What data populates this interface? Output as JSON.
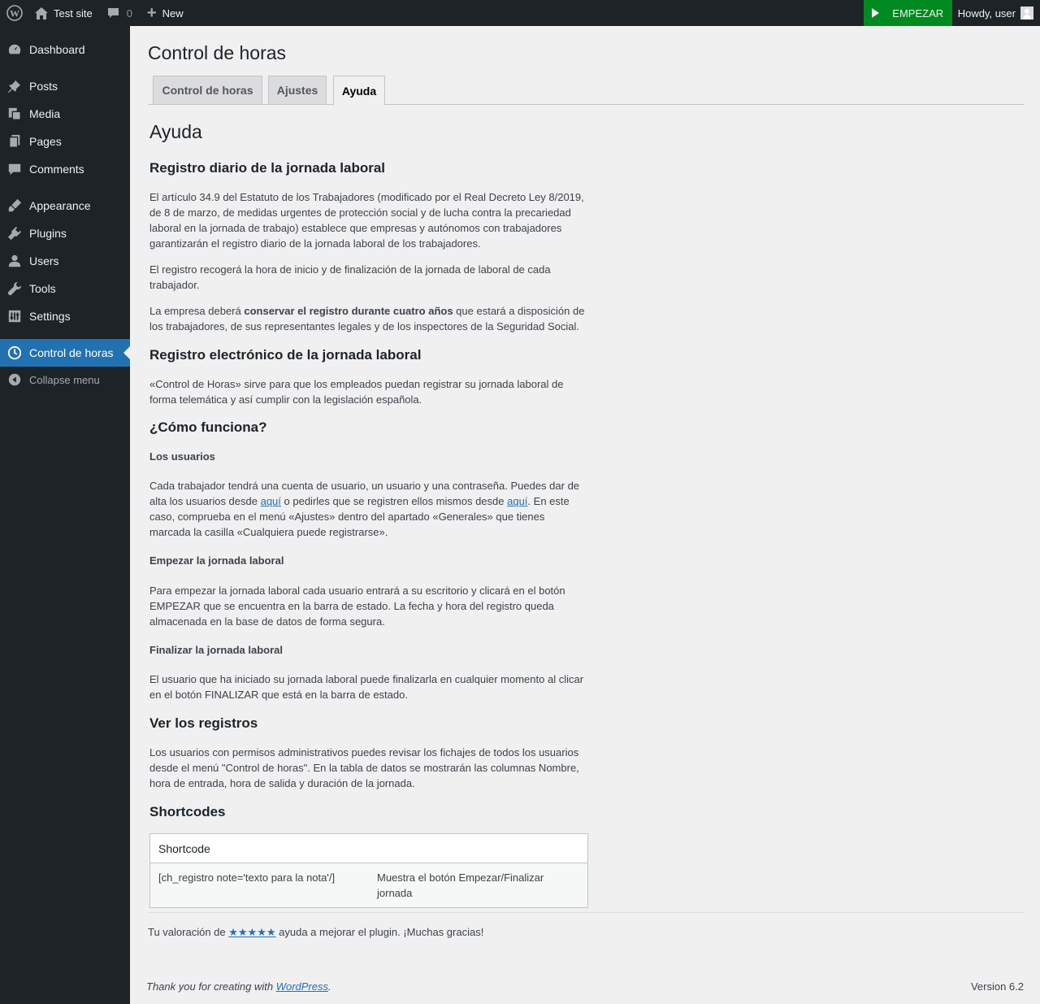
{
  "adminbar": {
    "site_name": "Test site",
    "comments_count": "0",
    "new_label": "New",
    "empezar_label": "EMPEZAR",
    "howdy_label": "Howdy, user"
  },
  "sidebar": {
    "items": [
      {
        "label": "Dashboard",
        "icon": "dashboard-icon"
      },
      {
        "label": "Posts",
        "icon": "pin-icon"
      },
      {
        "label": "Media",
        "icon": "media-icon"
      },
      {
        "label": "Pages",
        "icon": "pages-icon"
      },
      {
        "label": "Comments",
        "icon": "comment-icon"
      },
      {
        "label": "Appearance",
        "icon": "brush-icon"
      },
      {
        "label": "Plugins",
        "icon": "plug-icon"
      },
      {
        "label": "Users",
        "icon": "user-icon"
      },
      {
        "label": "Tools",
        "icon": "wrench-icon"
      },
      {
        "label": "Settings",
        "icon": "settings-icon"
      },
      {
        "label": "Control de horas",
        "icon": "clock-icon"
      },
      {
        "label": "Collapse menu",
        "icon": "collapse-icon"
      }
    ]
  },
  "page": {
    "title": "Control de horas",
    "tabs": [
      {
        "label": "Control de horas"
      },
      {
        "label": "Ajustes"
      },
      {
        "label": "Ayuda"
      }
    ]
  },
  "help": {
    "title": "Ayuda",
    "s1_title": "Registro diario de la jornada laboral",
    "s1_p1": "El artículo 34.9 del Estatuto de los Trabajadores (modificado por el Real Decreto Ley 8/2019, de 8 de marzo, de medidas urgentes de protección social y de lucha contra la precariedad laboral en la jornada de trabajo) establece que empresas y autónomos con trabajadores garantizarán el registro diario de la jornada laboral de los trabajadores.",
    "s1_p2": "El registro recogerá la hora de inicio y de finalización de la jornada de laboral de cada trabajador.",
    "s1_p3_a": "La empresa deberá ",
    "s1_p3_b": "conservar el registro durante cuatro años",
    "s1_p3_c": " que estará a disposición de los trabajadores, de sus representantes legales y de los inspectores de la Seguridad Social.",
    "s2_title": "Registro electrónico de la jornada laboral",
    "s2_p1": "«Control de Horas» sirve para que los empleados puedan registrar su jornada laboral de forma telemática y así cumplir con la legislación española.",
    "s3_title": "¿Cómo funciona?",
    "users_title": "Los usuarios",
    "users_p_a": "Cada trabajador tendrá una cuenta de usuario, un usuario y una contraseña. Puedes dar de alta los usuarios desde ",
    "users_link1": "aquí",
    "users_p_b": " o pedirles que se registren ellos mismos desde ",
    "users_link2": "aquí",
    "users_p_c": ". En este caso, comprueba en el menú «Ajustes» dentro del apartado «Generales» que tienes marcada la casilla «Cualquiera puede registrarse».",
    "start_title": "Empezar la jornada laboral",
    "start_p": "Para empezar la jornada laboral cada usuario entrará a su escritorio y clicará en el botón EMPEZAR que se encuentra en la barra de estado. La fecha y hora del registro queda almacenada en la base de datos de forma segura.",
    "end_title": "Finalizar la jornada laboral",
    "end_p": "El usuario que ha iniciado su jornada laboral puede finalizarla en cualquier momento al clicar en el botón FINALIZAR que está en la barra de estado.",
    "s4_title": "Ver los registros",
    "s4_p": "Los usuarios con permisos administrativos puedes revisar los fichajes de todos los usuarios desde el menú \"Control de horas\". En la tabla de datos se mostrarán las columnas Nombre, hora de entrada, hora de salida y duración de la jornada.",
    "s5_title": "Shortcodes",
    "table_header": "Shortcode",
    "table_rows": [
      {
        "code": "[ch_registro note='texto para la nota'/]",
        "desc": "Muestra el botón Empezar/Finalizar jornada"
      }
    ]
  },
  "rating": {
    "prefix": "Tu valoración de ",
    "stars": "★★★★★",
    "suffix": " ayuda a mejorar el plugin. ¡Muchas gracias!"
  },
  "footer": {
    "thanks_a": "Thank you for creating with ",
    "thanks_link": "WordPress",
    "thanks_b": ".",
    "version": "Version 6.2"
  },
  "colors": {
    "adminbar_bg": "#1d2327",
    "accent": "#2271b1",
    "empezar_bg": "#008a20",
    "page_bg": "#f0f0f1"
  }
}
